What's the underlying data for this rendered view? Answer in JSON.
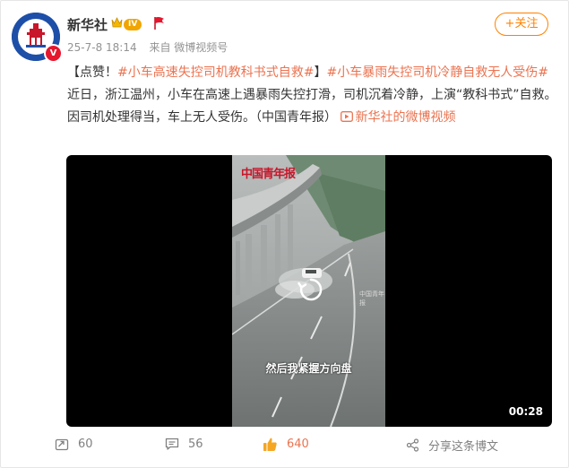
{
  "post": {
    "author": "新华社",
    "level_badge": "IV",
    "time": "25-7-8 18:14",
    "source": "来自 微博视频号",
    "follow_label": "+关注",
    "content": {
      "prefix": "【点赞！",
      "tag1": "#小车高速失控司机教科书式自救#",
      "mid": "】",
      "tag2": "#小车暴雨失控司机冷静自救无人受伤#",
      "body": "近日，浙江温州，小车在高速上遇暴雨失控打滑，司机沉着冷静，上演“教科书式”自救。因司机处理得当，车上无人受伤。（中国青年报）",
      "video_link": "新华社的微博视频"
    }
  },
  "video": {
    "watermark": "中国青年报",
    "small_watermark": "中国青年报",
    "subtitle": "然后我紧握方向盘",
    "duration": "00:28"
  },
  "actions": {
    "repost_count": "60",
    "comment_count": "56",
    "like_count": "640",
    "share_label": "分享这条博文"
  },
  "colors": {
    "accent": "#ff8200",
    "link": "#eb7350",
    "muted": "#939393"
  }
}
